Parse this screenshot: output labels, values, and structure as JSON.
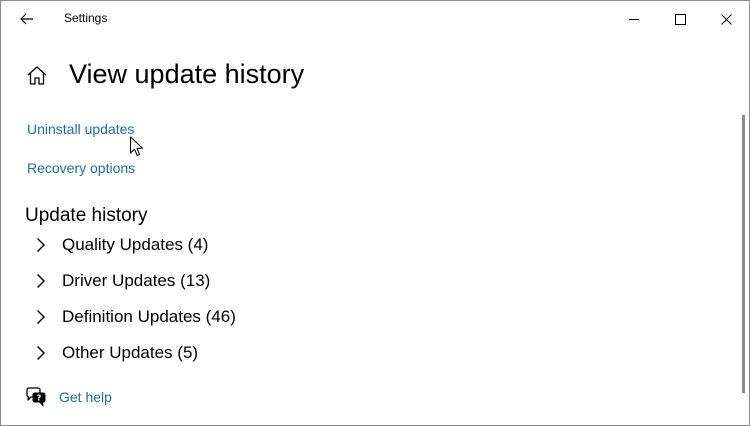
{
  "window": {
    "title": "Settings",
    "controls": [
      "minimize",
      "maximize",
      "close"
    ]
  },
  "header": {
    "home_icon": "home-icon",
    "title": "View update history"
  },
  "links": {
    "uninstall": "Uninstall updates",
    "recovery": "Recovery options"
  },
  "update_history": {
    "title": "Update history",
    "categories": [
      {
        "label": "Quality Updates (4)"
      },
      {
        "label": "Driver Updates (13)"
      },
      {
        "label": "Definition Updates (46)"
      },
      {
        "label": "Other Updates (5)"
      }
    ]
  },
  "help": {
    "icon": "help-chat-icon",
    "label": "Get help"
  },
  "colors": {
    "link": "#1c6ea8",
    "text": "#000000",
    "background": "#ffffff"
  }
}
